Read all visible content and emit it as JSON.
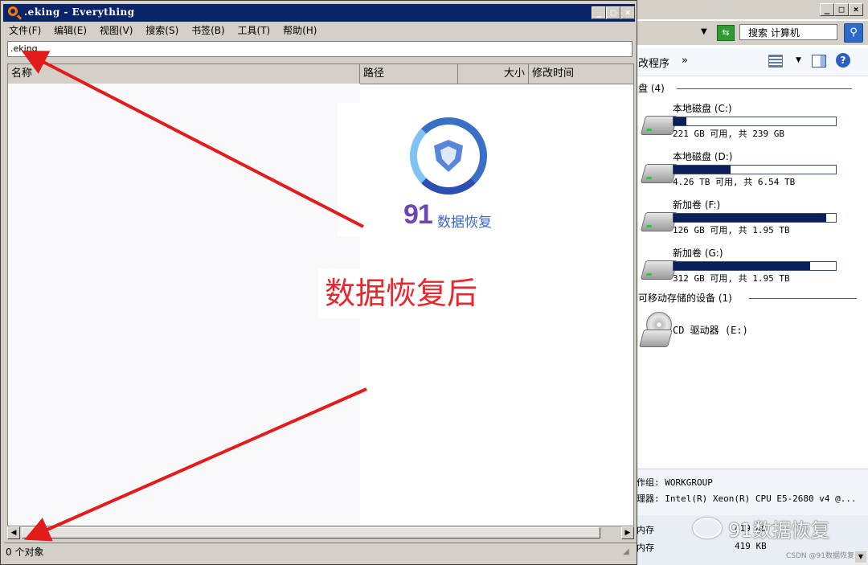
{
  "everything": {
    "title": ".eking - Everything",
    "menu": [
      "文件(F)",
      "编辑(E)",
      "视图(V)",
      "搜索(S)",
      "书签(B)",
      "工具(T)",
      "帮助(H)"
    ],
    "search_value": ".eking",
    "columns": [
      "名称",
      "路径",
      "大小",
      "修改时间"
    ],
    "status": "0 个对象",
    "window_buttons": [
      "_",
      "□",
      "×"
    ]
  },
  "explorer": {
    "search_placeholder": "搜索 计算机",
    "toolbar_label": "改程序",
    "toolbar_more": "»",
    "hard_disks_header": "盘 (4)",
    "drives": [
      {
        "name": "本地磁盘 (C:)",
        "info": "221 GB 可用, 共 239 GB",
        "used_fraction": 0.08
      },
      {
        "name": "本地磁盘 (D:)",
        "info": "4.26 TB 可用, 共 6.54 TB",
        "used_fraction": 0.35
      },
      {
        "name": "新加卷 (F:)",
        "info": "126 GB 可用, 共 1.95 TB",
        "used_fraction": 0.94
      },
      {
        "name": "新加卷 (G:)",
        "info": "312 GB 可用, 共 1.95 TB",
        "used_fraction": 0.84
      }
    ],
    "removable_header": "可移动存储的设备 (1)",
    "cd_drive": "CD 驱动器 (E:)",
    "details": {
      "workgroup": "作组: WORKGROUP",
      "processor": "理器: Intel(R) Xeon(R) CPU E5-2680 v4 @...",
      "row1_label": "内存",
      "row1_value": "419 KB",
      "row2_label": "内存",
      "row2_value": "419 KB"
    }
  },
  "overlay": {
    "logo_number": "91",
    "logo_text": "数据恢复",
    "caption": "数据恢复后",
    "watermark": "91数据恢复",
    "csdn": "CSDN @91数据恢复"
  },
  "colors": {
    "title_bar": "#0a246a",
    "caption_red": "#e8262c",
    "arrow_red": "#e31b1b",
    "drive_fill": "#0a1f5c"
  }
}
